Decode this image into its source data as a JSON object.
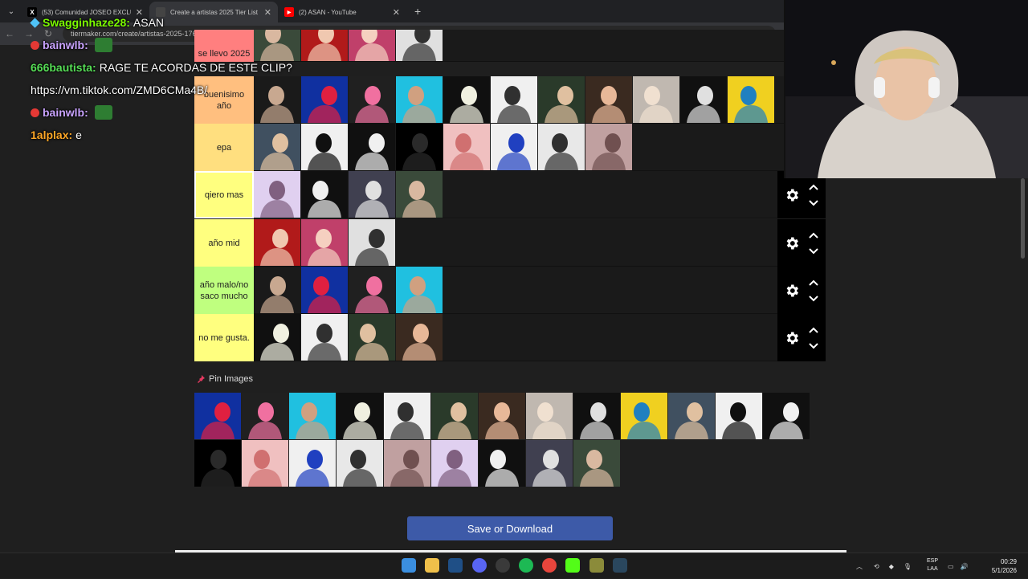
{
  "browser": {
    "tabs": [
      {
        "title": "(53) Comunidad JOSEO EXCLU",
        "icon": "x-logo-icon",
        "active": false
      },
      {
        "title": "Create a artistas 2025 Tier List",
        "icon": "tiermaker-icon",
        "active": true
      },
      {
        "title": "(2) ASAN - YouTube",
        "icon": "youtube-icon",
        "active": false
      }
    ],
    "url": "tiermaker.com/create/artistas-2025-17641534"
  },
  "chat": [
    {
      "user": "Swagginhaze28:",
      "color": "#7cfc00",
      "badge": "cube",
      "text": "ASAN"
    },
    {
      "user": "bainwlb:",
      "color": "#c9a3ff",
      "badge": "dot",
      "text": ""
    },
    {
      "user": "666bautista:",
      "color": "#55dd55",
      "badge": "",
      "text": "RAGE TE ACORDAS DE ESTE CLIP?"
    },
    {
      "user": "",
      "color": "#ffffff",
      "badge": "",
      "text": "https://vm.tiktok.com/ZMD6CMa4B/"
    },
    {
      "user": "bainwlb:",
      "color": "#c9a3ff",
      "badge": "dot",
      "text": ""
    },
    {
      "user": "1alplax:",
      "color": "#ffa726",
      "badge": "",
      "text": "e"
    }
  ],
  "tiers": [
    {
      "label": "se llevo 2025",
      "color": "#ff7f7f",
      "count": 4,
      "selected": false,
      "partial": true
    },
    {
      "label": "buenisimo año",
      "color": "#ffbf7f",
      "count": 11,
      "selected": false
    },
    {
      "label": "epa",
      "color": "#ffdf7f",
      "count": 8,
      "selected": false
    },
    {
      "label": "qiero mas",
      "color": "#ffff7f",
      "count": 4,
      "selected": true
    },
    {
      "label": "año mid",
      "color": "#ffff7f",
      "count": 3,
      "selected": false
    },
    {
      "label": "año malo/no saco mucho",
      "color": "#bfff7f",
      "count": 4,
      "selected": false
    },
    {
      "label": "no me gusta.",
      "color": "#ffff7f",
      "count": 4,
      "selected": false
    }
  ],
  "pin_images_label": "Pin Images",
  "pool_count": 22,
  "save_button": "Save or Download",
  "taskbar": {
    "lang_top": "ESP",
    "lang_bottom": "LAA",
    "time": "00:29",
    "date": "5/1/2026"
  },
  "colors": {
    "save_button": "#3d5aa8",
    "accent": "#1a1a1a"
  }
}
